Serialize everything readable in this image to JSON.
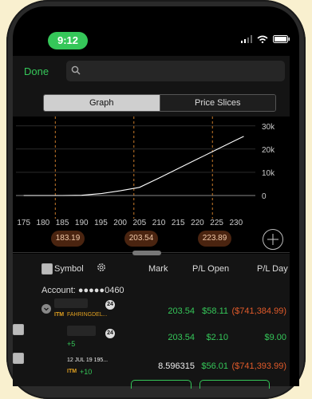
{
  "status_bar": {
    "time": "9:12"
  },
  "header": {
    "done_label": "Done",
    "search_placeholder": ""
  },
  "tabs": [
    {
      "label": "Graph",
      "active": true
    },
    {
      "label": "Price Slices",
      "active": false
    }
  ],
  "chart_data": {
    "type": "line",
    "x": [
      175,
      180,
      185,
      190,
      195,
      200,
      205,
      210,
      215,
      220,
      225,
      230,
      232
    ],
    "y": [
      0,
      0,
      0,
      100,
      800,
      2000,
      3500,
      7500,
      11600,
      15700,
      19800,
      23900,
      25500
    ],
    "x_ticks": [
      "175",
      "180",
      "185",
      "190",
      "195",
      "200",
      "205",
      "210",
      "215",
      "220",
      "225",
      "230"
    ],
    "y_ticks": [
      "30k",
      "20k",
      "10k",
      "0"
    ],
    "x_range": [
      173,
      235
    ],
    "y_range": [
      -10000,
      32000
    ],
    "reference_lines": [
      183.19,
      203.54,
      223.89
    ],
    "reference_labels": [
      "183.19",
      "203.54",
      "223.89"
    ],
    "grid": true,
    "colors": {
      "line": "#ffffff",
      "reference": "#c87a2a",
      "grid": "#444444",
      "zero": "#888888"
    }
  },
  "positions": {
    "header": {
      "symbol": "Symbol",
      "mark": "Mark",
      "pl_open": "P/L Open",
      "pl_day": "P/L Day"
    },
    "account_label": "Account: ●●●●●0460",
    "rows": [
      {
        "badge": "24",
        "tag": "ITM",
        "desc": "FAHRINGDEL...",
        "mark": "203.54",
        "pl_open": "$58.11",
        "pl_day": "($741,384.99)"
      },
      {
        "badge": "24",
        "qty": "+5",
        "mark": "203.54",
        "pl_open": "$2.10",
        "pl_day": "$9.00"
      },
      {
        "desc": "12 JUL 19 195...",
        "tag": "ITM",
        "qty": "+10",
        "mark": "8.596315",
        "pl_open": "$56.01",
        "pl_day": "($741,393.99)"
      }
    ]
  },
  "icons": {
    "search": "search-icon",
    "settings": "gear-icon",
    "chart_zoom": "crosshair-icon",
    "signal": "signal-icon",
    "wifi": "wifi-icon",
    "battery": "battery-icon"
  }
}
